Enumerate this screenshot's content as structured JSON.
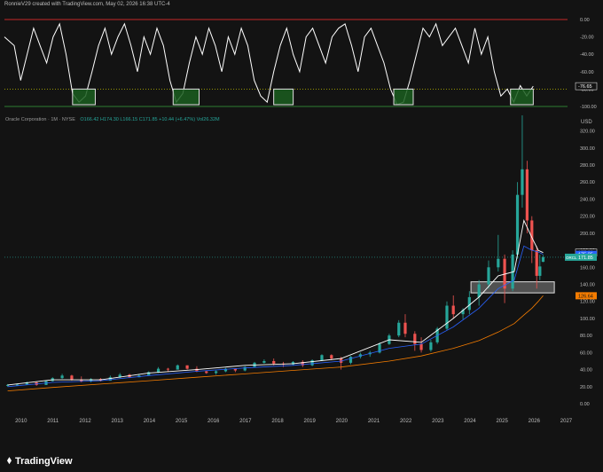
{
  "header": {
    "caption": "RonnieV29 created with TradingView.com, May 02, 2026 16:38 UTC-4"
  },
  "indicator": {
    "y_ticks": [
      "0.00",
      "-20.00",
      "-40.00",
      "-60.00",
      "-80.00",
      "-100.00"
    ],
    "current_value": "-76.65",
    "upper_level": 0,
    "lower_level": -80,
    "bottom_level": -100,
    "colors": {
      "line": "#ffffff",
      "upper": "#c62828",
      "lower_dotted": "#c0c000",
      "bottom": "#2e7d32",
      "box_fill": "#1b5e20",
      "box_border": "#e0e0e0"
    }
  },
  "legend": {
    "symbol": "Oracle Corporation · 1M · NYSE",
    "open": "O166.42",
    "high": "H174.30",
    "low": "L166.15",
    "close": "C171.85",
    "change": "+10.44 (+6.47%)",
    "volume": "Vol26.32M"
  },
  "price_axis": {
    "currency": "USD",
    "ticks": [
      "320.00",
      "300.00",
      "280.00",
      "260.00",
      "240.00",
      "220.00",
      "200.00",
      "180.00",
      "160.00",
      "140.00",
      "120.00",
      "100.00",
      "80.00",
      "60.00",
      "40.00",
      "20.00",
      "0.00"
    ],
    "labels": [
      {
        "text": "177.32",
        "value": 177.32,
        "color": "#ffffff",
        "bg": "#131313"
      },
      {
        "text": "175.25",
        "value": 175.25,
        "color": "#ffffff",
        "bg": "#2962ff"
      },
      {
        "text": "171.85",
        "value": 171.85,
        "color": "#ffffff",
        "bg": "#26a69a"
      },
      {
        "text": "126.64",
        "value": 126.64,
        "color": "#131313",
        "bg": "#f57c00"
      }
    ],
    "orcl_tag": "ORCL"
  },
  "time_axis": {
    "ticks": [
      "2010",
      "2011",
      "2012",
      "2013",
      "2014",
      "2015",
      "2016",
      "2017",
      "2018",
      "2019",
      "2020",
      "2021",
      "2022",
      "2023",
      "2024",
      "2025",
      "2026",
      "2027"
    ]
  },
  "footer": {
    "logo_text": "TradingView"
  },
  "chart_data": [
    {
      "type": "line",
      "title": "",
      "series": [
        {
          "x": [
            2010.0,
            2010.3,
            2010.5,
            2010.7,
            2010.9,
            2011.1,
            2011.3,
            2011.5,
            2011.7,
            2011.9,
            2012.1,
            2012.3,
            2012.5,
            2012.7,
            2012.9,
            2013.1,
            2013.3,
            2013.5,
            2013.7,
            2013.9,
            2014.1,
            2014.3,
            2014.5,
            2014.7,
            2014.9,
            2015.1,
            2015.3,
            2015.5,
            2015.7,
            2015.9,
            2016.1,
            2016.3,
            2016.5,
            2016.7,
            2016.9,
            2017.1,
            2017.3,
            2017.5,
            2017.7,
            2017.9,
            2018.1,
            2018.3,
            2018.5,
            2018.7,
            2018.9,
            2019.1,
            2019.3,
            2019.5,
            2019.7,
            2019.9,
            2020.1,
            2020.3,
            2020.5,
            2020.7,
            2020.9,
            2021.1,
            2021.3,
            2021.5,
            2021.7,
            2021.9,
            2022.1,
            2022.3,
            2022.5,
            2022.7,
            2022.9,
            2023.1,
            2023.3,
            2023.5,
            2023.7,
            2023.9,
            2024.1,
            2024.3,
            2024.5,
            2024.7,
            2024.9,
            2025.1,
            2025.3,
            2025.5,
            2025.7,
            2025.9,
            2026.1,
            2026.3
          ],
          "values": [
            -20,
            -30,
            -70,
            -40,
            -10,
            -30,
            -50,
            -20,
            -5,
            -40,
            -85,
            -95,
            -88,
            -60,
            -30,
            -10,
            -40,
            -20,
            -5,
            -30,
            -60,
            -20,
            -40,
            -10,
            -30,
            -70,
            -95,
            -85,
            -50,
            -20,
            -40,
            -10,
            -30,
            -60,
            -20,
            -40,
            -10,
            -30,
            -70,
            -88,
            -95,
            -60,
            -30,
            -10,
            -40,
            -60,
            -20,
            -10,
            -30,
            -50,
            -20,
            -10,
            -5,
            -30,
            -60,
            -20,
            -10,
            -30,
            -50,
            -80,
            -98,
            -95,
            -70,
            -40,
            -10,
            -20,
            -5,
            -30,
            -20,
            -10,
            -30,
            -50,
            -10,
            -40,
            -20,
            -60,
            -88,
            -80,
            -95,
            -76,
            -88,
            -76.65
          ]
        }
      ],
      "ylim": [
        -100,
        0
      ]
    },
    {
      "type": "candlestick",
      "title": "Oracle Corporation · 1M · NYSE",
      "ylabel": "USD",
      "ylim": [
        0,
        330
      ],
      "xlim": [
        2009.5,
        2027.2
      ],
      "candles": [
        [
          2009.6,
          21,
          23,
          20,
          22
        ],
        [
          2009.9,
          22,
          23,
          21,
          22.5
        ],
        [
          2010.2,
          22.5,
          26,
          22,
          25
        ],
        [
          2010.5,
          25,
          25.5,
          21,
          22
        ],
        [
          2010.8,
          22,
          27,
          22,
          26.5
        ],
        [
          2011.0,
          26.5,
          31,
          26,
          30
        ],
        [
          2011.3,
          30,
          35,
          29,
          33
        ],
        [
          2011.6,
          33,
          34,
          27,
          28
        ],
        [
          2011.9,
          28,
          32,
          25,
          26
        ],
        [
          2012.2,
          26,
          30,
          25,
          29
        ],
        [
          2012.5,
          29,
          30,
          26,
          27
        ],
        [
          2012.8,
          27,
          33,
          27,
          31
        ],
        [
          2013.1,
          31,
          36,
          30,
          34
        ],
        [
          2013.4,
          34,
          35,
          30,
          31
        ],
        [
          2013.7,
          31,
          35,
          31,
          33
        ],
        [
          2014.0,
          33,
          38,
          33,
          37
        ],
        [
          2014.3,
          37,
          43,
          36,
          41
        ],
        [
          2014.6,
          41,
          42,
          38,
          40
        ],
        [
          2014.9,
          40,
          46,
          40,
          45
        ],
        [
          2015.2,
          45,
          45,
          40,
          41
        ],
        [
          2015.5,
          41,
          44,
          37,
          38
        ],
        [
          2015.8,
          38,
          39,
          35,
          36
        ],
        [
          2016.1,
          36,
          39,
          34,
          38
        ],
        [
          2016.4,
          38,
          42,
          37,
          41
        ],
        [
          2016.7,
          41,
          41,
          37,
          39
        ],
        [
          2017.0,
          39,
          44,
          38,
          43
        ],
        [
          2017.3,
          43,
          49,
          43,
          48
        ],
        [
          2017.6,
          48,
          52,
          47,
          50
        ],
        [
          2017.9,
          50,
          53,
          45,
          47
        ],
        [
          2018.2,
          47,
          49,
          43,
          46
        ],
        [
          2018.5,
          46,
          50,
          45,
          49
        ],
        [
          2018.8,
          49,
          51,
          43,
          45
        ],
        [
          2019.1,
          45,
          52,
          44,
          51
        ],
        [
          2019.4,
          51,
          58,
          50,
          57
        ],
        [
          2019.7,
          57,
          58,
          51,
          53
        ],
        [
          2020.0,
          53,
          55,
          40,
          48
        ],
        [
          2020.3,
          48,
          56,
          46,
          55
        ],
        [
          2020.6,
          55,
          60,
          53,
          58
        ],
        [
          2020.9,
          58,
          62,
          55,
          60
        ],
        [
          2021.2,
          60,
          72,
          59,
          70
        ],
        [
          2021.5,
          70,
          82,
          69,
          80
        ],
        [
          2021.8,
          80,
          98,
          78,
          95
        ],
        [
          2022.0,
          95,
          105,
          78,
          82
        ],
        [
          2022.3,
          82,
          85,
          62,
          70
        ],
        [
          2022.5,
          70,
          78,
          60,
          63
        ],
        [
          2022.8,
          63,
          75,
          61,
          72
        ],
        [
          2023.0,
          72,
          90,
          70,
          88
        ],
        [
          2023.3,
          88,
          120,
          86,
          115
        ],
        [
          2023.5,
          115,
          127,
          100,
          105
        ],
        [
          2023.8,
          105,
          112,
          99,
          110
        ],
        [
          2024.0,
          110,
          132,
          105,
          125
        ],
        [
          2024.3,
          125,
          145,
          115,
          140
        ],
        [
          2024.6,
          140,
          168,
          135,
          160
        ],
        [
          2024.9,
          160,
          198,
          155,
          170
        ],
        [
          2025.1,
          170,
          175,
          118,
          135
        ],
        [
          2025.35,
          135,
          180,
          132,
          175
        ],
        [
          2025.5,
          175,
          260,
          170,
          245
        ],
        [
          2025.65,
          245,
          345,
          230,
          275
        ],
        [
          2025.8,
          275,
          285,
          200,
          215
        ],
        [
          2025.95,
          215,
          220,
          165,
          180
        ],
        [
          2026.1,
          180,
          185,
          135,
          150
        ],
        [
          2026.2,
          150,
          175,
          145,
          161
        ],
        [
          2026.3,
          166.42,
          174.3,
          166.15,
          171.85
        ]
      ],
      "series": [
        {
          "name": "",
          "color": "#ffffff",
          "x": [
            2009.6,
            2011,
            2012.5,
            2014,
            2015.5,
            2017,
            2018.5,
            2020,
            2021.5,
            2022.5,
            2023.5,
            2024.3,
            2024.9,
            2025.4,
            2025.7,
            2025.95,
            2026.15,
            2026.3
          ],
          "values": [
            22,
            28,
            28,
            36,
            40,
            45,
            47,
            53,
            75,
            72,
            100,
            125,
            150,
            155,
            215,
            195,
            180,
            177.32
          ]
        },
        {
          "name": "",
          "color": "#2962ff",
          "x": [
            2009.6,
            2011,
            2012.5,
            2014,
            2015.5,
            2017,
            2018.5,
            2020,
            2021.5,
            2022.5,
            2023.5,
            2024.3,
            2024.9,
            2025.4,
            2025.7,
            2025.95,
            2026.15,
            2026.3
          ],
          "values": [
            20,
            25,
            27,
            33,
            38,
            42,
            45,
            50,
            65,
            70,
            90,
            112,
            135,
            145,
            185,
            180,
            178,
            175.25
          ]
        },
        {
          "name": "",
          "color": "#f57c00",
          "x": [
            2009.6,
            2011,
            2012.5,
            2014,
            2015.5,
            2017,
            2018.5,
            2020,
            2021.5,
            2022.5,
            2023.5,
            2024.3,
            2024.9,
            2025.4,
            2025.7,
            2025.95,
            2026.15,
            2026.3
          ],
          "values": [
            15,
            19,
            23,
            27,
            31,
            35,
            39,
            43,
            50,
            56,
            65,
            74,
            84,
            94,
            104,
            112,
            120,
            126.64
          ]
        }
      ],
      "annotation_box": {
        "x": [
          2024.05,
          2026.65
        ],
        "y": [
          130,
          143
        ]
      }
    }
  ]
}
